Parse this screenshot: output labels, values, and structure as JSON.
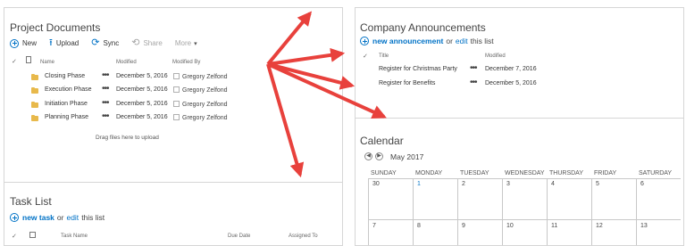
{
  "project_documents": {
    "title": "Project Documents",
    "toolbar": {
      "new_label": "New",
      "upload_label": "Upload",
      "sync_label": "Sync",
      "share_label": "Share",
      "more_label": "More"
    },
    "columns": {
      "name": "Name",
      "modified": "Modified",
      "modified_by": "Modified By"
    },
    "rows": [
      {
        "name": "Closing Phase",
        "modified": "December 5, 2016",
        "modified_by": "Gregory Zelfond"
      },
      {
        "name": "Execution Phase",
        "modified": "December 5, 2016",
        "modified_by": "Gregory Zelfond"
      },
      {
        "name": "Initiation Phase",
        "modified": "December 5, 2016",
        "modified_by": "Gregory Zelfond"
      },
      {
        "name": "Planning Phase",
        "modified": "December 5, 2016",
        "modified_by": "Gregory Zelfond"
      }
    ],
    "drop_hint": "Drag files here to upload"
  },
  "task_list": {
    "title": "Task List",
    "new_label": "new task",
    "or_label": "or",
    "edit_label": "edit",
    "tail_label": "this list",
    "columns": {
      "task_name": "Task Name",
      "due_date": "Due Date",
      "assigned_to": "Assigned To"
    }
  },
  "announcements": {
    "title": "Company Announcements",
    "new_label": "new announcement",
    "or_label": "or",
    "edit_label": "edit",
    "tail_label": "this list",
    "columns": {
      "title": "Title",
      "modified": "Modified"
    },
    "rows": [
      {
        "title": "Register for Christmas Party",
        "modified": "December 7, 2016"
      },
      {
        "title": "Register for Benefits",
        "modified": "December 5, 2016"
      }
    ]
  },
  "calendar": {
    "title": "Calendar",
    "month": "May 2017",
    "weekdays": [
      "SUNDAY",
      "MONDAY",
      "TUESDAY",
      "WEDNESDAY",
      "THURSDAY",
      "FRIDAY",
      "SATURDAY"
    ],
    "week1": [
      "30",
      "1",
      "2",
      "3",
      "4",
      "5",
      "6"
    ],
    "week2": [
      "7",
      "8",
      "9",
      "10",
      "11",
      "12",
      "13"
    ]
  },
  "colors": {
    "accent": "#0072c6",
    "arrow": "#e8413c",
    "folder": "#e8b94b"
  }
}
